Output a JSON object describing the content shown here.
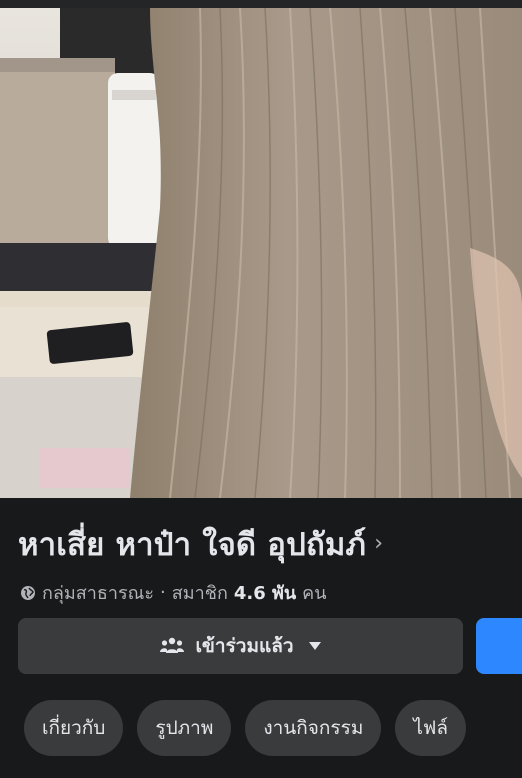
{
  "cover": {
    "image_description_icon": "cover-photo"
  },
  "group": {
    "title": "หาเสี่ย หาป๋า ใจดี อุปถัมภ์",
    "privacy": "กลุ่มสาธารณะ",
    "separator": "·",
    "members_label": "สมาชิก",
    "members_count": "4.6 พัน",
    "members_unit": "คน"
  },
  "actions": {
    "joined_label": "เข้าร่วมแล้ว"
  },
  "tabs": [
    {
      "label": "เกี่ยวกับ"
    },
    {
      "label": "รูปภาพ"
    },
    {
      "label": "งานกิจกรรม"
    },
    {
      "label": "ไฟล์"
    }
  ],
  "colors": {
    "background": "#18191a",
    "button_bg": "#3a3b3c",
    "accent_blue": "#2d88ff",
    "text_primary": "#e4e6eb",
    "text_secondary": "#b0b3b8"
  }
}
